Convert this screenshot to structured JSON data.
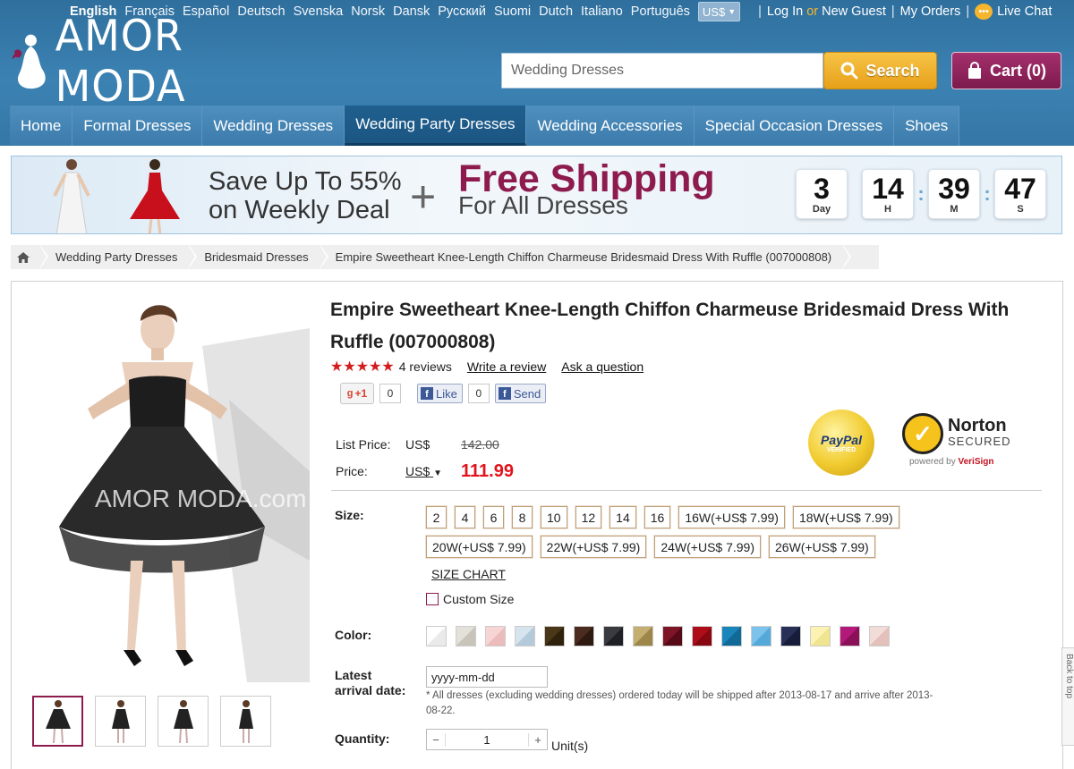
{
  "topbar": {
    "languages": [
      "English",
      "Français",
      "Español",
      "Deutsch",
      "Svenska",
      "Norsk",
      "Dansk",
      "Русский",
      "Suomi",
      "Dutch",
      "Italiano",
      "Português"
    ],
    "currency": "US$",
    "login": "Log In",
    "or": "or",
    "new_guest": "New Guest",
    "my_orders": "My Orders",
    "live_chat": "Live Chat"
  },
  "logo": {
    "text": "AMOR MODA"
  },
  "search": {
    "value": "Wedding Dresses",
    "button": "Search"
  },
  "cart": {
    "label": "Cart (0)"
  },
  "nav": [
    "Home",
    "Formal Dresses",
    "Wedding Dresses",
    "Wedding Party Dresses",
    "Wedding Accessories",
    "Special Occasion Dresses",
    "Shoes"
  ],
  "banner": {
    "line1": "Save Up To 55%",
    "line2": "on Weekly Deal",
    "plus": "+",
    "free": "Free Shipping",
    "for_all": "For All Dresses",
    "countdown": [
      {
        "value": "3",
        "unit": "Day"
      },
      {
        "value": "14",
        "unit": "H"
      },
      {
        "value": "39",
        "unit": "M"
      },
      {
        "value": "47",
        "unit": "S"
      }
    ],
    "colon": ":"
  },
  "breadcrumb": [
    "Wedding Party Dresses",
    "Bridesmaid Dresses",
    "Empire Sweetheart Knee-Length Chiffon Charmeuse Bridesmaid Dress With Ruffle (007000808)"
  ],
  "product": {
    "title": "Empire Sweetheart Knee-Length Chiffon Charmeuse Bridesmaid Dress With Ruffle (007000808)",
    "rating_stars": 5,
    "stars": "★★★★★",
    "reviews": "4 reviews",
    "write_review": "Write a review",
    "ask_question": "Ask a question",
    "social": {
      "gplus": "+1",
      "gplus_count": "0",
      "like": "Like",
      "like_count": "0",
      "send": "Send"
    },
    "list_price_label": "List Price:",
    "list_currency": "US$",
    "list_price": "142.00",
    "price_label": "Price:",
    "price_currency": "US$",
    "price": "111.99",
    "watermark": "AMOR MODA.com"
  },
  "badges": {
    "paypal": "PayPal",
    "paypal_sub": "VERIFIED",
    "norton": "Norton",
    "secured": "SECURED",
    "powered": "powered by",
    "verisign": "VeriSign"
  },
  "options": {
    "size_label": "Size:",
    "sizes": [
      "2",
      "4",
      "6",
      "8",
      "10",
      "12",
      "14",
      "16",
      "16W(+US$ 7.99)",
      "18W(+US$ 7.99)",
      "20W(+US$ 7.99)",
      "22W(+US$ 7.99)",
      "24W(+US$ 7.99)",
      "26W(+US$ 7.99)"
    ],
    "size_chart": "SIZE CHART",
    "custom_size": "Custom Size",
    "color_label": "Color:",
    "colors": [
      "#ffffff",
      "#d9d6cf",
      "#f4c9c9",
      "#c7d9e8",
      "#3a2a12",
      "#3a2218",
      "#2c2d33",
      "#b39e5e",
      "#6b0f1f",
      "#9e0b16",
      "#1677a8",
      "#6bb6e2",
      "#1e2547",
      "#f8eea4",
      "#a01466",
      "#ecd0cc"
    ],
    "arrival_label_1": "Latest",
    "arrival_label_2": "arrival date:",
    "date_placeholder": "yyyy-mm-dd",
    "note": "* All dresses (excluding wedding dresses) ordered today will be shipped after 2013-08-17 and arrive after 2013-08-22.",
    "quantity_label": "Quantity:",
    "quantity": "1",
    "minus": "−",
    "plus": "+",
    "units": "Unit(s)"
  },
  "back_to_top": "Back to top"
}
